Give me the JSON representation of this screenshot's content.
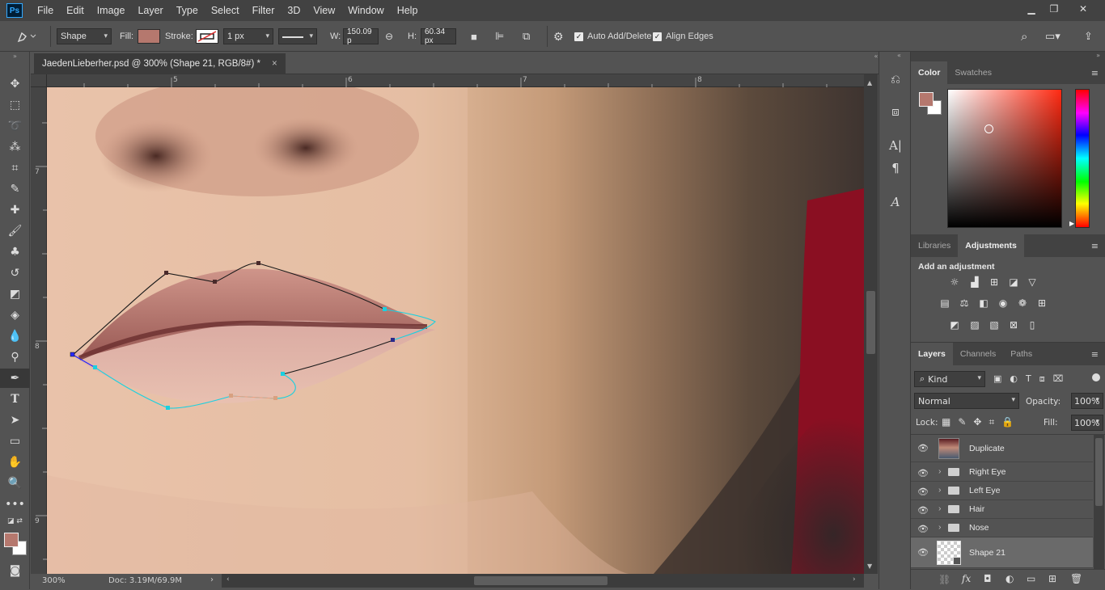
{
  "app": {
    "logo": "Ps",
    "menu": [
      "File",
      "Edit",
      "Image",
      "Layer",
      "Type",
      "Select",
      "Filter",
      "3D",
      "View",
      "Window",
      "Help"
    ],
    "window_controls": [
      "minimize-icon",
      "restore-icon",
      "close-icon"
    ]
  },
  "options_bar": {
    "mode": "Shape",
    "fill_label": "Fill:",
    "fill_color": "#b5786e",
    "stroke_label": "Stroke:",
    "stroke_width": "1 px",
    "w_label": "W:",
    "w_value": "150.09 p",
    "h_label": "H:",
    "h_value": "60.34 px",
    "auto_add_delete": "Auto Add/Delete",
    "align_edges": "Align Edges"
  },
  "document": {
    "tab_title": "JaedenLieberher.psd @ 300% (Shape 21, RGB/8#) *",
    "close": "×",
    "ruler_top": [
      "5",
      "6",
      "7",
      "8"
    ],
    "ruler_left": [
      "7",
      "8",
      "9"
    ],
    "zoom": "300%",
    "doc_size": "Doc: 3.19M/69.9M"
  },
  "color_panel": {
    "tabs": [
      "Color",
      "Swatches"
    ],
    "foreground": "#b5786e",
    "background": "#ffffff",
    "hue": "#ff3a1a"
  },
  "adjustments_panel": {
    "tabs": [
      "Libraries",
      "Adjustments"
    ],
    "heading": "Add an adjustment",
    "row1": [
      "brightness-icon",
      "levels-icon",
      "curves-icon",
      "exposure-icon"
    ],
    "row2": [
      "vibrance-icon",
      "hue-saturation-icon",
      "color-balance-icon",
      "black-white-icon",
      "photo-filter-icon",
      "channel-mixer-icon"
    ],
    "row3": [
      "invert-icon",
      "posterize-icon",
      "threshold-icon",
      "selective-color-icon",
      "gradient-map-icon"
    ]
  },
  "layers_panel": {
    "tabs": [
      "Layers",
      "Channels",
      "Paths"
    ],
    "kind": "Kind",
    "blend_mode": "Normal",
    "opacity_label": "Opacity:",
    "opacity": "100%",
    "lock_label": "Lock:",
    "fill_label": "Fill:",
    "fill": "100%",
    "layers": [
      {
        "name": "Duplicate",
        "type": "image"
      },
      {
        "name": "Right Eye",
        "type": "group"
      },
      {
        "name": "Left Eye",
        "type": "group"
      },
      {
        "name": "Hair",
        "type": "group"
      },
      {
        "name": "Nose",
        "type": "group"
      },
      {
        "name": "Shape 21",
        "type": "shape",
        "selected": true
      }
    ],
    "footer_icons": [
      "link-icon",
      "fx-icon",
      "mask-icon",
      "adjustment-layer-icon",
      "new-group-icon",
      "new-layer-icon",
      "trash-icon"
    ]
  }
}
